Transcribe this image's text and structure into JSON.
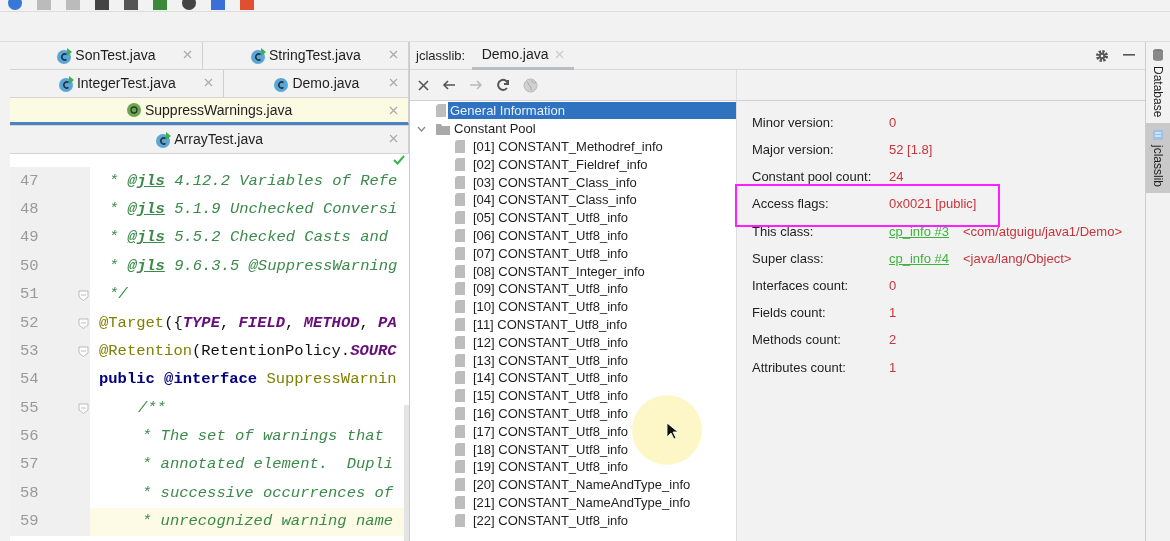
{
  "editor": {
    "tab_rows": [
      [
        {
          "label": "SonTest.java",
          "kind": "runnable",
          "selected": false
        },
        {
          "label": "StringTest.java",
          "kind": "runnable",
          "selected": false
        }
      ],
      [
        {
          "label": "IntegerTest.java",
          "kind": "runnable",
          "selected": false
        },
        {
          "label": "Demo.java",
          "kind": "class",
          "selected": false
        }
      ],
      [
        {
          "label": "SuppressWarnings.java",
          "kind": "annotation",
          "selected": true
        }
      ],
      [
        {
          "label": "ArrayTest.java",
          "kind": "runnable",
          "selected": false
        }
      ]
    ],
    "code_lines": [
      {
        "number": "47",
        "kind": "doc",
        "current": false,
        "segments": [
          {
            "kind": "doc",
            "text": "* "
          },
          {
            "kind": "tag",
            "text": "@jls"
          },
          {
            "kind": "doc",
            "text": " 4.12.2 Variables of Refe"
          }
        ]
      },
      {
        "number": "48",
        "kind": "doc",
        "current": false,
        "segments": [
          {
            "kind": "doc",
            "text": "* "
          },
          {
            "kind": "tag",
            "text": "@jls"
          },
          {
            "kind": "doc",
            "text": " 5.1.9 Unchecked Conversi"
          }
        ]
      },
      {
        "number": "49",
        "kind": "doc",
        "current": false,
        "segments": [
          {
            "kind": "doc",
            "text": "* "
          },
          {
            "kind": "tag",
            "text": "@jls"
          },
          {
            "kind": "doc",
            "text": " 5.5.2 Checked Casts and"
          }
        ]
      },
      {
        "number": "50",
        "kind": "doc",
        "current": false,
        "segments": [
          {
            "kind": "doc",
            "text": "* "
          },
          {
            "kind": "tag",
            "text": "@jls"
          },
          {
            "kind": "doc",
            "text": " 9.6.3.5 @SuppressWarning"
          }
        ]
      },
      {
        "number": "51",
        "kind": "doc",
        "current": false,
        "fold": true,
        "segments": [
          {
            "kind": "doc",
            "text": "*/"
          }
        ]
      },
      {
        "number": "52",
        "kind": "code",
        "current": false,
        "fold": true,
        "segments": [
          {
            "kind": "annotation",
            "text": "@Target"
          },
          {
            "kind": "plain",
            "text": "({"
          },
          {
            "kind": "const",
            "text": "TYPE"
          },
          {
            "kind": "plain",
            "text": ", "
          },
          {
            "kind": "const",
            "text": "FIELD"
          },
          {
            "kind": "plain",
            "text": ", "
          },
          {
            "kind": "const",
            "text": "METHOD"
          },
          {
            "kind": "plain",
            "text": ", "
          },
          {
            "kind": "const",
            "text": "PA"
          }
        ]
      },
      {
        "number": "53",
        "kind": "code",
        "current": false,
        "fold": true,
        "segments": [
          {
            "kind": "annotation",
            "text": "@Retention"
          },
          {
            "kind": "plain",
            "text": "(RetentionPolicy."
          },
          {
            "kind": "const",
            "text": "SOURC"
          }
        ]
      },
      {
        "number": "54",
        "kind": "code",
        "current": false,
        "segments": [
          {
            "kind": "keyword",
            "text": "public"
          },
          {
            "kind": "keyword",
            "text": " @interface"
          },
          {
            "kind": "annotation",
            "text": " SuppressWarnin"
          }
        ]
      },
      {
        "number": "55",
        "kind": "member-doc",
        "current": false,
        "fold": true,
        "segments": [
          {
            "kind": "doc",
            "text": "/**"
          }
        ]
      },
      {
        "number": "56",
        "kind": "member-doc-body",
        "current": false,
        "segments": [
          {
            "kind": "doc",
            "text": "* The set of warnings that"
          }
        ]
      },
      {
        "number": "57",
        "kind": "member-doc-body",
        "current": false,
        "segments": [
          {
            "kind": "doc",
            "text": "* annotated element.  Dupli"
          }
        ]
      },
      {
        "number": "58",
        "kind": "member-doc-body",
        "current": false,
        "segments": [
          {
            "kind": "doc",
            "text": "* successive occurrences of"
          }
        ]
      },
      {
        "number": "59",
        "kind": "member-doc-body",
        "current": true,
        "segments": [
          {
            "kind": "doc",
            "text": "* unrecognized warning name"
          }
        ]
      }
    ]
  },
  "jclasslib": {
    "label": "jclasslib:",
    "tabs": [
      {
        "label": "Demo.java",
        "selected": true
      }
    ],
    "tree": [
      {
        "label": "General Information",
        "kind": "file",
        "selected": true
      },
      {
        "label": "Constant Pool",
        "kind": "folder",
        "selected": false,
        "expanded": true,
        "children": [
          {
            "label": "[01] CONSTANT_Methodref_info",
            "kind": "file",
            "selected": false
          },
          {
            "label": "[02] CONSTANT_Fieldref_info",
            "kind": "file",
            "selected": false
          },
          {
            "label": "[03] CONSTANT_Class_info",
            "kind": "file",
            "selected": false
          },
          {
            "label": "[04] CONSTANT_Class_info",
            "kind": "file",
            "selected": false
          },
          {
            "label": "[05] CONSTANT_Utf8_info",
            "kind": "file",
            "selected": false
          },
          {
            "label": "[06] CONSTANT_Utf8_info",
            "kind": "file",
            "selected": false
          },
          {
            "label": "[07] CONSTANT_Utf8_info",
            "kind": "file",
            "selected": false
          },
          {
            "label": "[08] CONSTANT_Integer_info",
            "kind": "file",
            "selected": false
          },
          {
            "label": "[09] CONSTANT_Utf8_info",
            "kind": "file",
            "selected": false
          },
          {
            "label": "[10] CONSTANT_Utf8_info",
            "kind": "file",
            "selected": false
          },
          {
            "label": "[11] CONSTANT_Utf8_info",
            "kind": "file",
            "selected": false
          },
          {
            "label": "[12] CONSTANT_Utf8_info",
            "kind": "file",
            "selected": false
          },
          {
            "label": "[13] CONSTANT_Utf8_info",
            "kind": "file",
            "selected": false
          },
          {
            "label": "[14] CONSTANT_Utf8_info",
            "kind": "file",
            "selected": false
          },
          {
            "label": "[15] CONSTANT_Utf8_info",
            "kind": "file",
            "selected": false
          },
          {
            "label": "[16] CONSTANT_Utf8_info",
            "kind": "file",
            "selected": false
          },
          {
            "label": "[17] CONSTANT_Utf8_info",
            "kind": "file",
            "selected": false
          },
          {
            "label": "[18] CONSTANT_Utf8_info",
            "kind": "file",
            "selected": false
          },
          {
            "label": "[19] CONSTANT_Utf8_info",
            "kind": "file",
            "selected": false
          },
          {
            "label": "[20] CONSTANT_NameAndType_info",
            "kind": "file",
            "selected": false
          },
          {
            "label": "[21] CONSTANT_NameAndType_info",
            "kind": "file",
            "selected": false
          },
          {
            "label": "[22] CONSTANT_Utf8_info",
            "kind": "file",
            "selected": false
          }
        ]
      }
    ],
    "details": [
      {
        "label": "Minor version:",
        "value": "0",
        "highlighted": false
      },
      {
        "label": "Major version:",
        "value": "52 [1.8]",
        "highlighted": false
      },
      {
        "label": "Constant pool count:",
        "value": "24",
        "highlighted": false
      },
      {
        "label": "Access flags:",
        "value": "0x0021 [public]",
        "highlighted": true
      },
      {
        "label": "This class:",
        "link": "cp_info #3",
        "value": "<com/atguigu/java1/Demo>",
        "highlighted": false
      },
      {
        "label": "Super class:",
        "link": "cp_info #4",
        "value": "<java/lang/Object>",
        "highlighted": false
      },
      {
        "label": "Interfaces count:",
        "value": "0",
        "highlighted": false
      },
      {
        "label": "Fields count:",
        "value": "1",
        "highlighted": false
      },
      {
        "label": "Methods count:",
        "value": "2",
        "highlighted": false
      },
      {
        "label": "Attributes count:",
        "value": "1",
        "highlighted": false
      }
    ]
  },
  "side_tabs": [
    {
      "label": "Database",
      "kind": "database",
      "selected": false
    },
    {
      "label": "jclasslib",
      "kind": "jclasslib",
      "selected": true
    }
  ]
}
